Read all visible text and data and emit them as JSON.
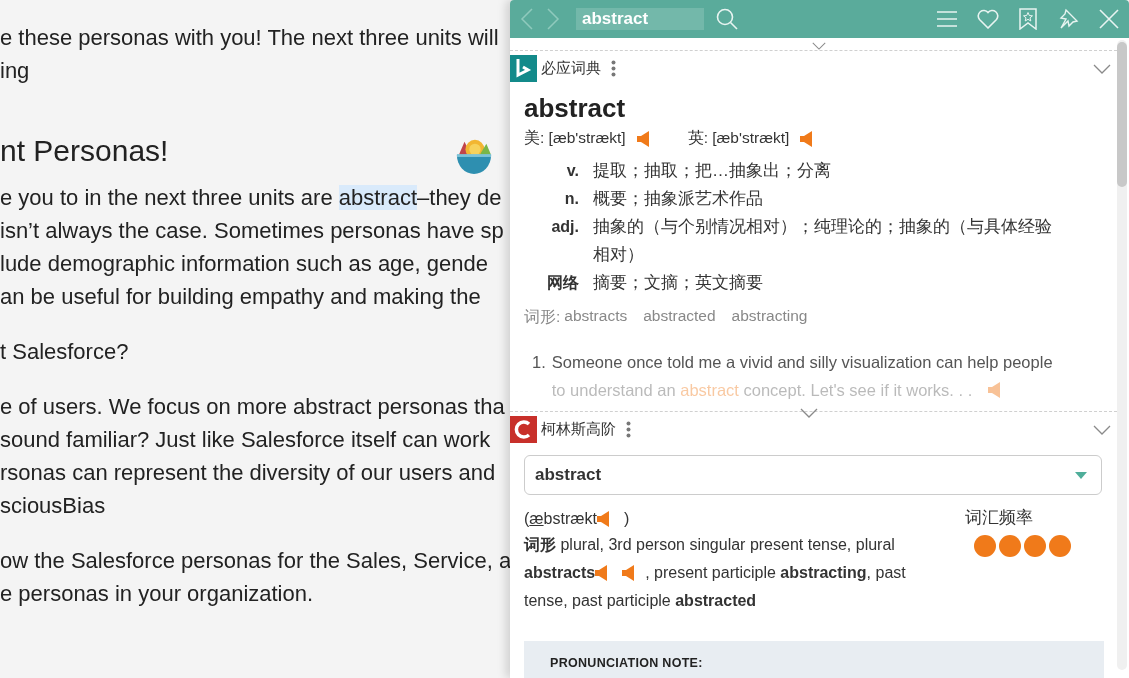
{
  "article": {
    "lines": [
      {
        "kind": "text",
        "text": "e these personas with you! The next three units will"
      },
      {
        "kind": "text",
        "text": "ing"
      },
      {
        "kind": "heading",
        "text": "nt Personas!"
      },
      {
        "kind": "marked",
        "before": "e you to in the next three units are ",
        "marked": "abstract",
        "after": "–they de"
      },
      {
        "kind": "text",
        "text": "isn’t always the case. Sometimes personas have sp"
      },
      {
        "kind": "text",
        "text": "lude demographic information such as age, gende"
      },
      {
        "kind": "text",
        "text": "an be useful for building empathy and making the"
      },
      {
        "kind": "gap"
      },
      {
        "kind": "text",
        "text": "t Salesforce?"
      },
      {
        "kind": "gap"
      },
      {
        "kind": "text",
        "text": "e of users. We focus on more abstract personas tha"
      },
      {
        "kind": "text",
        "text": "sound familiar? Just like Salesforce itself can work"
      },
      {
        "kind": "text",
        "text": "rsonas can represent the diversity of our users and"
      },
      {
        "kind": "text",
        "text": "sciousBias"
      },
      {
        "kind": "gap"
      },
      {
        "kind": "text",
        "text": "ow the Salesforce personas for the Sales, Service, a"
      },
      {
        "kind": "text",
        "text": "e personas in your organization."
      }
    ]
  },
  "popup": {
    "search": {
      "value": "abstract"
    },
    "bing": {
      "name": "必应词典",
      "collapsed": false,
      "word": "abstract",
      "pronunciations": [
        {
          "label": "美: [æb'strækt]"
        },
        {
          "label": "英: [æb'strækt]"
        }
      ],
      "definitions": [
        {
          "pos": "v.",
          "text": "提取；抽取；把…抽象出；分离"
        },
        {
          "pos": "n.",
          "text": "概要；抽象派艺术作品"
        },
        {
          "pos": "adj.",
          "text": "抽象的（与个别情况相对）；纯理论的；抽象的（与具体经验相对）"
        },
        {
          "pos": "网络",
          "text": "摘要；文摘；英文摘要"
        }
      ],
      "forms_label": "词形:",
      "forms": [
        "abstracts",
        "abstracted",
        "abstracting"
      ],
      "example": {
        "number": "1.",
        "lines": [
          {
            "before": "Someone once told me a vivid and silly visualization can help people",
            "faded": false
          },
          {
            "before": "to understand an ",
            "marked": "abstract",
            "after": " concept. Let's see if it works. . .",
            "faded": true
          }
        ]
      }
    },
    "collins": {
      "name": "柯林斯高阶",
      "collapsed": false,
      "select": "abstract",
      "phonetic": {
        "open": "(",
        "stressed": "æ",
        "rest": "bstrækt",
        "close": ")"
      },
      "forms": [
        {
          "kind": "text",
          "text": "**词形** plural, 3rd person singular present tense, plural"
        },
        {
          "kind": "audio",
          "before": "**abstracts**",
          "after": ", present participle **abstracting**, past"
        },
        {
          "kind": "text",
          "text": "tense, past participle **abstracted**"
        }
      ],
      "frequency_label": "词汇频率",
      "stars": 4,
      "note": "PRONUNCIATION NOTE:"
    }
  }
}
